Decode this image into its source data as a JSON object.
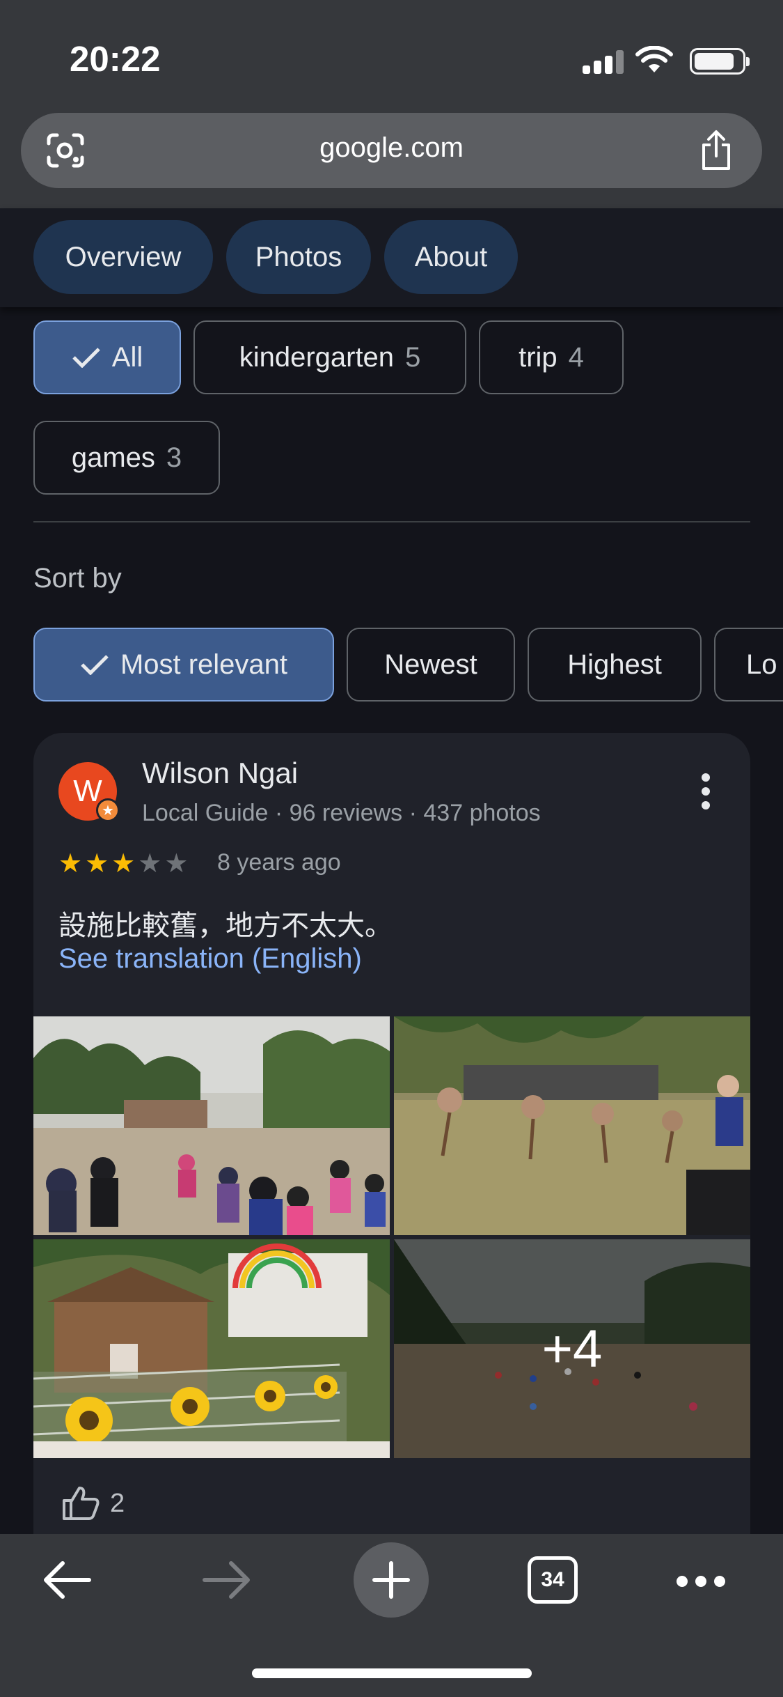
{
  "status_bar": {
    "time": "20:22",
    "battery_level": 0.85
  },
  "browser": {
    "url": "google.com",
    "tabs_count": "34"
  },
  "place_tabs": [
    {
      "label": "Overview"
    },
    {
      "label": "Photos"
    },
    {
      "label": "About"
    }
  ],
  "topic_filters": [
    {
      "label": "All",
      "count": "",
      "selected": true
    },
    {
      "label": "kindergarten",
      "count": "5",
      "selected": false
    },
    {
      "label": "trip",
      "count": "4",
      "selected": false
    },
    {
      "label": "games",
      "count": "3",
      "selected": false
    }
  ],
  "sort": {
    "label": "Sort by",
    "options": [
      {
        "label": "Most relevant",
        "selected": true
      },
      {
        "label": "Newest",
        "selected": false
      },
      {
        "label": "Highest",
        "selected": false
      },
      {
        "label": "Lo",
        "selected": false
      }
    ]
  },
  "review": {
    "author": "Wilson Ngai",
    "avatar_letter": "W",
    "avatar_color": "#e8481f",
    "author_meta": "Local Guide · 96 reviews · 437 photos",
    "rating": 3,
    "rating_max": 5,
    "date": "8 years ago",
    "text": "設施比較舊，地方不太大。",
    "translate_link": "See translation (English)",
    "more_photos": "+4",
    "likes": "2"
  },
  "colors": {
    "accent_link": "#8ab4f8",
    "star": "#fbbc04",
    "selected_chip": "#3d5b8c"
  }
}
